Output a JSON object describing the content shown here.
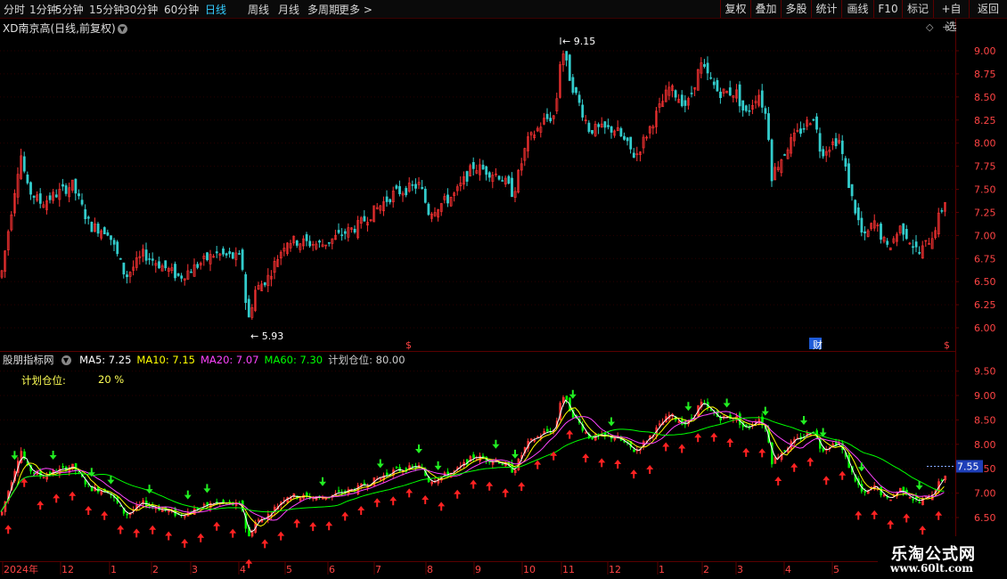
{
  "toolbar": {
    "periods": [
      "分时",
      "1分钟",
      "5分钟",
      "15分钟",
      "30分钟",
      "60分钟",
      "日线",
      "周线",
      "月线",
      "多周期",
      "更多 >"
    ],
    "active_period": "日线",
    "right": [
      "复权",
      "叠加",
      "多股",
      "统计",
      "画线",
      "F10",
      "标记",
      "+自选",
      "返回"
    ]
  },
  "stock": {
    "title": "XD南京高(日线,前复权)",
    "high_label": "9.15",
    "low_label": "5.93",
    "markers": [
      "$",
      "财",
      "$"
    ]
  },
  "price_axis": [
    "9.00",
    "8.75",
    "8.50",
    "8.25",
    "8.00",
    "7.75",
    "7.50",
    "7.25",
    "7.00",
    "6.75",
    "6.50",
    "6.25",
    "6.00"
  ],
  "indicator": {
    "name": "股朋指标网",
    "items": [
      {
        "label": "MA5: 7.25",
        "color": "#ffffff"
      },
      {
        "label": "MA10: 7.15",
        "color": "#ffff00"
      },
      {
        "label": "MA20: 7.07",
        "color": "#ff44ff"
      },
      {
        "label": "MA60: 7.30",
        "color": "#00ff00"
      },
      {
        "label": "计划仓位: 80.00",
        "color": "#cccccc"
      }
    ],
    "position_label": "计划仓位:",
    "position_value": "20  %",
    "axis": [
      "9.50",
      "9.00",
      "8.50",
      "8.00",
      "7.50",
      "7.00",
      "6.50"
    ],
    "current_price": "7.55"
  },
  "date_axis": [
    "2024年",
    "12",
    "1",
    "2",
    "3",
    "4",
    "5",
    "6",
    "7",
    "8",
    "9",
    "10",
    "11",
    "12",
    "1",
    "2",
    "3",
    "4",
    "5"
  ],
  "watermark": {
    "title": "乐淘公式网",
    "url": "www.60lt.com"
  },
  "colors": {
    "up": "#ff3333",
    "down": "#33cccc",
    "ind_up": "#ff3333",
    "ind_down": "#00ff00",
    "grid": "#5a0000",
    "axis_text": "#ff4444"
  }
}
